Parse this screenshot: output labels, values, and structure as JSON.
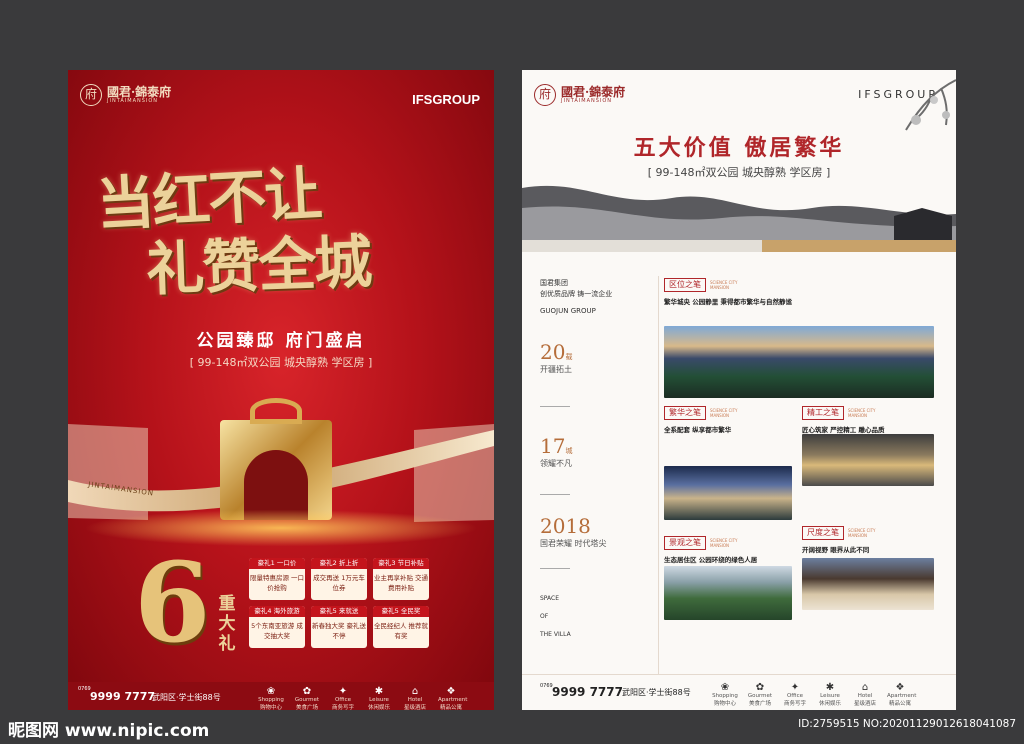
{
  "left": {
    "logo_mark": "府",
    "logo_name": "國君·錦泰府",
    "logo_sub": "JINTAIMANSION",
    "brand": "IFSGROUP",
    "calligraphy_line1": "当红不让",
    "calligraphy_line2": "礼赞全城",
    "tagline": "公园臻邸  府门盛启",
    "subtagline": "[ 99-148㎡双公园  城央醇熟  学区房 ]",
    "ribbon_text": "JINTAIMANSION",
    "big_number": "6",
    "big_label": "重大礼",
    "gifts": [
      {
        "title": "豪礼1 一口价",
        "body": "限量特惠房源 一口价抢购"
      },
      {
        "title": "豪礼2 折上折",
        "body": "成交再送 1万元车位券"
      },
      {
        "title": "豪礼3 节日补贴",
        "body": "业主再享补贴 交通费用补贴"
      },
      {
        "title": "豪礼4 海外旅游",
        "body": "5个东南亚旅游 成交抽大奖"
      },
      {
        "title": "豪礼5 来就送",
        "body": "新春独大奖 豪礼送不停"
      },
      {
        "title": "豪礼5 全民奖",
        "body": "全民经纪人 推荐就有奖"
      }
    ],
    "phone": "9999 7777",
    "phone_prefix": "0769",
    "address": "武阳区·学士街88号",
    "colors": {
      "primary": "#b5121a",
      "gold": "#e6c37a"
    }
  },
  "right": {
    "logo_mark": "府",
    "logo_name": "國君·錦泰府",
    "logo_sub": "JINTAIMANSION",
    "brand": "IFSGROUP",
    "title": "五大价值  傲居繁华",
    "subtitle": "[ 99-148㎡双公园  城央醇熟  学区房 ]",
    "group_line1": "国君集团",
    "group_line2": "创优质品牌 铸一流企业",
    "group_en": "GUOJUN GROUP",
    "stats": [
      {
        "num": "20",
        "unit": "载",
        "desc": "开疆拓土"
      },
      {
        "num": "17",
        "unit": "城",
        "desc": "领耀不凡"
      },
      {
        "num": "2018",
        "unit": "",
        "desc": "国君荣耀  时代塔尖"
      }
    ],
    "space_lines": [
      "SPACE",
      "OF",
      "THE VILLA"
    ],
    "sections": [
      {
        "title": "区位之笔",
        "en": "SCIENCE CITY MANSION",
        "keyline": "繁华城央  公园静里  秉得都市繁华与自然静谧"
      },
      {
        "title": "繁华之笔",
        "en": "SCIENCE CITY MANSION",
        "keyline": "全系配套  纵享都市繁华"
      },
      {
        "title": "精工之笔",
        "en": "SCIENCE CITY MANSION",
        "keyline": "匠心筑家  严控精工  雕心品质"
      },
      {
        "title": "景观之笔",
        "en": "SCIENCE CITY MANSION",
        "keyline": "生态居住区  公园环绕的绿色人居"
      },
      {
        "title": "尺度之笔",
        "en": "SCIENCE CITY MANSION",
        "keyline": "开阔视野  眼界从此不同"
      }
    ],
    "phone": "9999 7777",
    "phone_prefix": "0769",
    "address": "武阳区·学士街88号",
    "colors": {
      "accent": "#b0262a"
    }
  },
  "footer_icons": [
    {
      "sym": "❀",
      "en": "Shopping",
      "cn": "购物中心"
    },
    {
      "sym": "✿",
      "en": "Gourmet",
      "cn": "美食广场"
    },
    {
      "sym": "✦",
      "en": "Office",
      "cn": "商务写字"
    },
    {
      "sym": "✱",
      "en": "Leisure",
      "cn": "休闲娱乐"
    },
    {
      "sym": "⌂",
      "en": "Hotel",
      "cn": "星级酒店"
    },
    {
      "sym": "❖",
      "en": "Apartment",
      "cn": "精品公寓"
    }
  ],
  "watermark_site": "昵图网 www.nipic.com",
  "watermark_id": "ID:2759515 NO:20201129012618041087"
}
